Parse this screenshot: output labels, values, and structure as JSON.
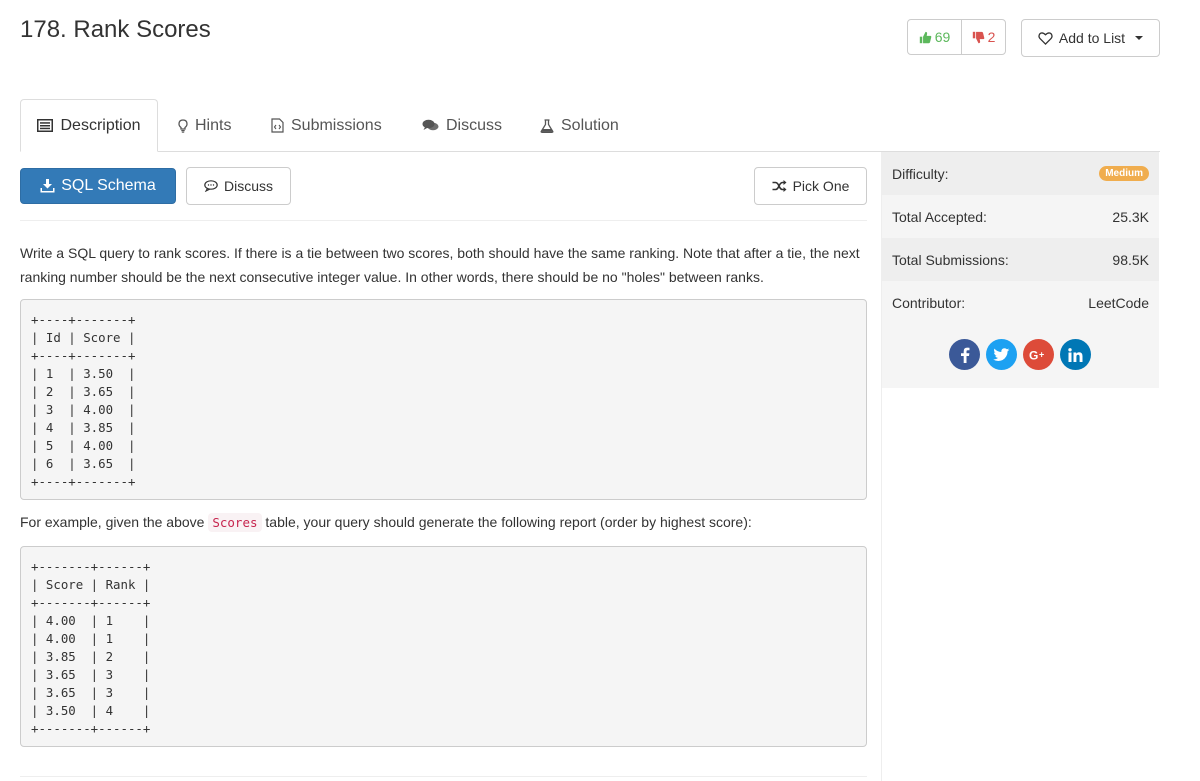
{
  "problem": {
    "title": "178. Rank Scores",
    "upvotes": "69",
    "downvotes": "2",
    "add_to_list_label": "Add to List"
  },
  "tabs": [
    {
      "label": "Description",
      "icon": "description-icon",
      "active": true
    },
    {
      "label": "Hints",
      "icon": "lightbulb-icon"
    },
    {
      "label": "Submissions",
      "icon": "code-file-icon"
    },
    {
      "label": "Discuss",
      "icon": "comments-icon"
    },
    {
      "label": "Solution",
      "icon": "flask-icon"
    }
  ],
  "toolbar": {
    "sql_schema_label": "SQL Schema",
    "discuss_label": "Discuss",
    "pick_one_label": "Pick One"
  },
  "description": {
    "intro": "Write a SQL query to rank scores. If there is a tie between two scores, both should have the same ranking. Note that after a tie, the next ranking number should be the next consecutive integer value. In other words, there should be no \"holes\" between ranks.",
    "scores_table": "+----+-------+\n| Id | Score |\n+----+-------+\n| 1  | 3.50  |\n| 2  | 3.65  |\n| 3  | 4.00  |\n| 4  | 3.85  |\n| 5  | 4.00  |\n| 6  | 3.65  |\n+----+-------+",
    "example_prefix": "For example, given the above",
    "example_code": "Scores",
    "example_suffix": "table, your query should generate the following report (order by highest score):",
    "result_table": "+-------+------+\n| Score | Rank |\n+-------+------+\n| 4.00  | 1    |\n| 4.00  | 1    |\n| 3.85  | 2    |\n| 3.65  | 3    |\n| 3.65  | 3    |\n| 3.50  | 4    |\n+-------+------+"
  },
  "sidebar": {
    "difficulty_label": "Difficulty:",
    "difficulty_value": "Medium",
    "accepted_label": "Total Accepted:",
    "accepted_value": "25.3K",
    "submissions_label": "Total Submissions:",
    "submissions_value": "98.5K",
    "contributor_label": "Contributor:",
    "contributor_value": "LeetCode"
  },
  "colors": {
    "primary": "#337ab7",
    "upvote": "#5cb85c",
    "downvote": "#d9534f",
    "medium_badge": "#f0ad4e",
    "facebook": "#3b5998",
    "twitter": "#1da1f2",
    "google_plus": "#dd4b39",
    "linkedin": "#0077b5"
  }
}
